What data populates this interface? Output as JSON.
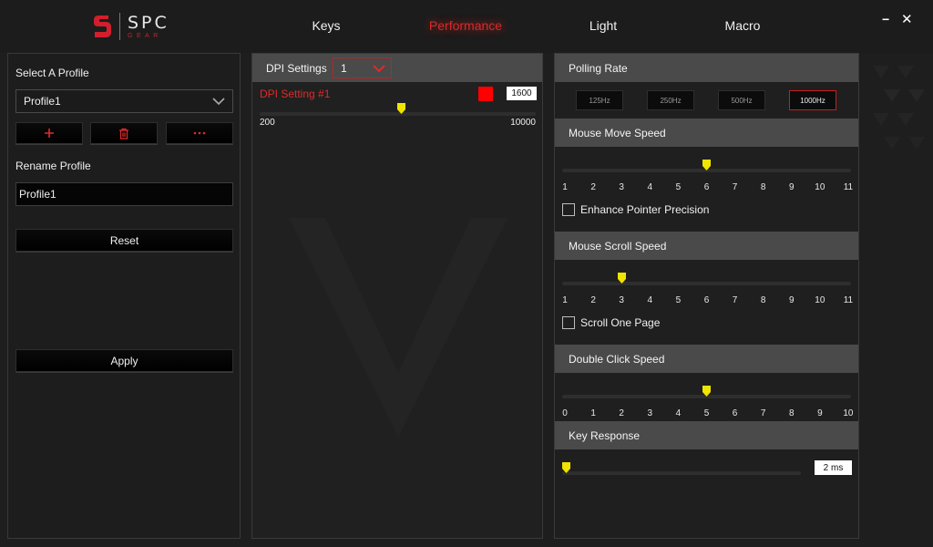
{
  "header": {
    "brand": "SPC",
    "brand_sub": "GEAR",
    "tabs": [
      {
        "label": "Keys",
        "active": false
      },
      {
        "label": "Performance",
        "active": true
      },
      {
        "label": "Light",
        "active": false
      },
      {
        "label": "Macro",
        "active": false
      }
    ],
    "minimize": "−",
    "close": "✕",
    "accent_color": "#d62a2a"
  },
  "profile": {
    "select_label": "Select A Profile",
    "selected": "Profile1",
    "add_icon": "plus-icon",
    "delete_icon": "trash-icon",
    "more_icon": "ellipsis-icon",
    "rename_label": "Rename Profile",
    "rename_value": "Profile1",
    "reset_label": "Reset",
    "apply_label": "Apply"
  },
  "dpi": {
    "title": "DPI Settings",
    "selected_level": "1",
    "setting_label": "DPI Setting #1",
    "color": "#ff0000",
    "value": "1600",
    "min": "200",
    "max": "10000",
    "current": 1600
  },
  "polling": {
    "title": "Polling Rate",
    "options": [
      "125Hz",
      "250Hz",
      "500Hz",
      "1000Hz"
    ],
    "selected": "1000Hz"
  },
  "move_speed": {
    "title": "Mouse Move Speed",
    "ticks": [
      "1",
      "2",
      "3",
      "4",
      "5",
      "6",
      "7",
      "8",
      "9",
      "10",
      "11"
    ],
    "value": 6,
    "option_label": "Enhance Pointer Precision",
    "option_checked": false
  },
  "scroll_speed": {
    "title": "Mouse Scroll Speed",
    "ticks": [
      "1",
      "2",
      "3",
      "4",
      "5",
      "6",
      "7",
      "8",
      "9",
      "10",
      "11"
    ],
    "value": 3,
    "option_label": "Scroll One Page",
    "option_checked": false
  },
  "double_click": {
    "title": "Double Click Speed",
    "ticks": [
      "0",
      "1",
      "2",
      "3",
      "4",
      "5",
      "6",
      "7",
      "8",
      "9",
      "10"
    ],
    "value": 5
  },
  "key_response": {
    "title": "Key Response",
    "value": "2 ms",
    "level": 0
  },
  "thumb_color": "#f0e400"
}
